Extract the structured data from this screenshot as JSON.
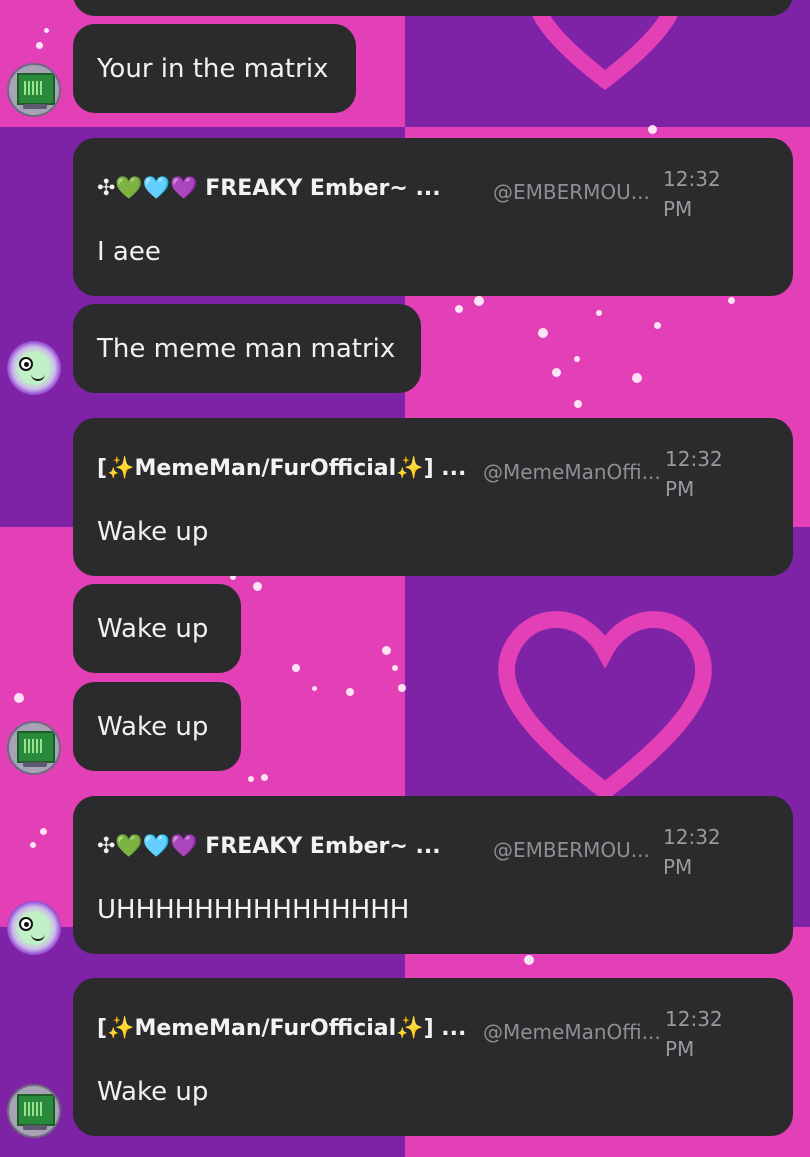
{
  "messages": {
    "m1": {
      "text": "Your in the matrix"
    },
    "m2": {
      "name": "✣💚🩵💜 FREAKY Ember~ ...",
      "handle": "@EMBERMOU...",
      "time": "12:32 PM",
      "body": "I aee"
    },
    "m3": {
      "text": "The meme man matrix"
    },
    "m4": {
      "name": "[✨MemeMan/FurOfficial✨] ...",
      "handle": "@MemeManOffi...",
      "time": "12:32 PM",
      "body": "Wake up"
    },
    "m5": {
      "text": "Wake up"
    },
    "m6": {
      "text": "Wake up"
    },
    "m7": {
      "name": "✣💚🩵💜 FREAKY Ember~ ...",
      "handle": "@EMBERMOU...",
      "time": "12:32 PM",
      "body": "UHHHHHHHHHHHHHHH"
    },
    "m8": {
      "name": "[✨MemeMan/FurOfficial✨] ...",
      "handle": "@MemeManOffi...",
      "time": "12:32 PM",
      "body": "Wake up"
    }
  },
  "colors": {
    "bubble": "#2b2b2d",
    "pink": "#e33fb6",
    "purple": "#7f23a6",
    "handle": "#8f8f93"
  },
  "avatars": [
    "tv-avatar",
    "blob-avatar",
    "tv-avatar",
    "blob-avatar",
    "tv-avatar"
  ]
}
